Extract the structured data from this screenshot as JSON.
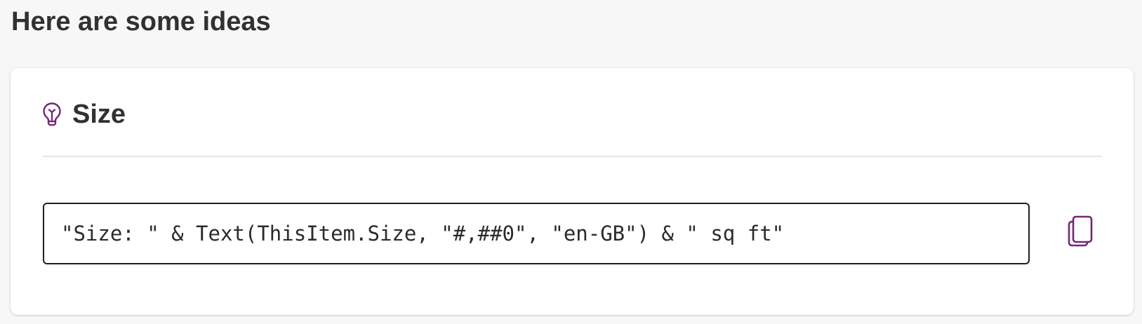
{
  "header": {
    "title": "Here are some ideas"
  },
  "idea_card": {
    "title": "Size",
    "icon": "lightbulb-icon",
    "formula": "\"Size: \" & Text(ThisItem.Size, \"#,##0\", \"en-GB\") & \" sq ft\"",
    "copy_icon": "copy-icon"
  },
  "colors": {
    "accent": "#742774",
    "text": "#323130",
    "background": "#f7f7f7",
    "card": "#ffffff"
  }
}
